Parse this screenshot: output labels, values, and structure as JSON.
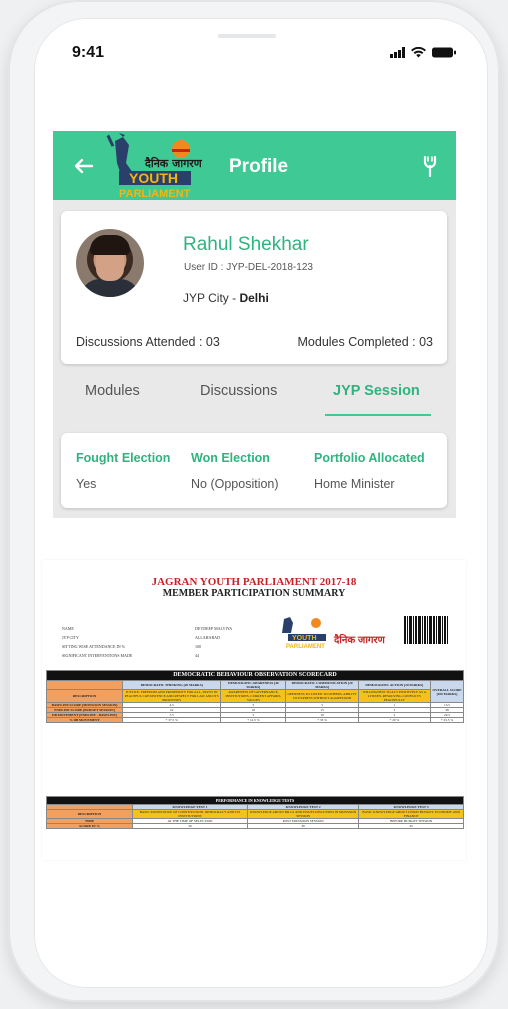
{
  "status_bar": {
    "time": "9:41"
  },
  "header": {
    "title": "Profile",
    "logo_text_hindi": "दैनिक जागरण",
    "logo_text_1": "YOUTH",
    "logo_text_2": "PARLIAMENT",
    "color": "#3ec995"
  },
  "profile": {
    "name": "Rahul Shekhar",
    "user_id": "User ID : JYP-DEL-2018-123",
    "city_label": "JYP City - ",
    "city": "Delhi",
    "discussions": "Discussions Attended : 03",
    "modules": "Modules Completed : 03"
  },
  "tabs": [
    {
      "label": "Modules"
    },
    {
      "label": "Discussions"
    },
    {
      "label": "JYP Session",
      "active": true
    }
  ],
  "session": {
    "cols": [
      {
        "header": "Fought Election",
        "value": "Yes"
      },
      {
        "header": "Won Election",
        "value": "No (Opposition)"
      },
      {
        "header": "Portfolio Allocated",
        "value": "Home Minister"
      }
    ]
  },
  "document": {
    "title": "JAGRAN YOUTH PARLIAMENT 2017-18",
    "subtitle": "MEMBER PARTICIPATION SUMMARY",
    "info_labels": [
      "NAME",
      "JYP CITY",
      "SITTING WISE ATTENDANCE IN %",
      "SIGNIFICANT INTERVENTIONS MADE"
    ],
    "info_values": [
      "DEVDEEP MALVIYA",
      "ALLAHABAD",
      "100",
      "44"
    ],
    "brand": "दैनिक जागरण",
    "scorecard_title": "DEMOCRATIC BEHAVIOUR OBSERVATION SCORECARD",
    "scorecard_headers": [
      "DEMOCRATIC THINKING [20 MARKS]",
      "DEMOCRATIC AWARENESS [40 MARKS]",
      "DEMOCRATIC COMMUNICATION [20 MARKS]",
      "DEMOCRATIC ACTION [20 MARKS]",
      "OVERALL SCORE [100 MARKS]"
    ],
    "description_label": "DESCRIPTION",
    "descriptions": [
      "JUSTICE, FREEDOM AND PROSPERITY FOR ALL, TRUST IN PEACEFUL COEXISTENCE AND RESPECT FOR LAW AND ITS PROCESSES",
      "AWARENESS OF GOVERNANCE, INSTITUTIONS, CURRENT AFFAIRS, VALUES",
      "OPENNESS TO LISTEN TO OTHERS, ABILITY TO EXPRESS WITHOUT AGGRESSION",
      "WILLINGNESS TO ACT POSITIVELY AS A CITIZEN, RESOLVING CONFLICTS PEACEFULLY"
    ],
    "rows": [
      {
        "label": "BASELINE SCORE [MONSOON SESSION]",
        "values": [
          "4.5",
          "5",
          "5",
          "1",
          "15.5"
        ]
      },
      {
        "label": "ENDLINE SCORE [BUDGET SESSION]",
        "values": [
          "10",
          "10",
          "15",
          "3",
          "38"
        ]
      },
      {
        "label": "DB MOVEMENT [ENDLINE - BASELINE]",
        "values": [
          "7.5",
          "5",
          "10",
          "2",
          "22.5"
        ]
      },
      {
        "label": "% DB MOVEMENT",
        "values": [
          "+ 37.5 %",
          "+ 12.5 %",
          "+ 33 %",
          "+ 20 %",
          "+ 25.5 %"
        ]
      }
    ],
    "knowledge_title": "PERFORMANCE IN KNOWLEDGE TESTS",
    "knowledge_headers": [
      "KNOWLEDGE TEST 1",
      "KNOWLEDGE TEST 2",
      "KNOWLEDGE TEST 3"
    ],
    "knowledge_desc": [
      "BASIC KNOWLEDGE OF CONSTITUTION, DEMOCRACY AND ITS INSTITUTIONS",
      "KNOWLEDGE ABOUT BILLS AND ISSUES DISCUSSED IN MONSOON SESSION",
      "BASIC KNOWLEDGE ABOUT UNION BUDGET, ECONOMY AND FINANCE"
    ],
    "time_label": "TIME",
    "times": [
      "AT THE TIME OF SELECTION",
      "POST MONSOON SESSION",
      "BEFORE BUDGET SESSION"
    ],
    "score_label": "SCORE IN %",
    "scores": [
      "30",
      "30",
      "45"
    ]
  }
}
